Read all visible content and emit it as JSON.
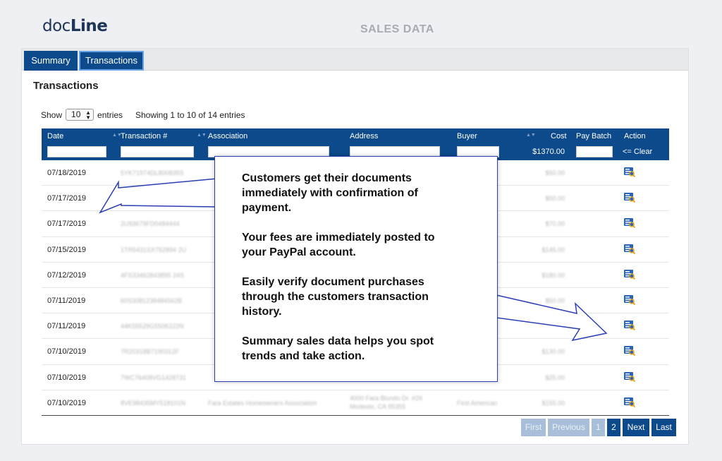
{
  "header": {
    "logo_part1": "doc",
    "logo_part2": "Line",
    "page_title": "SALES DATA"
  },
  "tabs": [
    {
      "label": "Summary"
    },
    {
      "label": "Transactions"
    }
  ],
  "section_title": "Transactions",
  "length_menu": {
    "show": "Show",
    "value": "10",
    "entries": "entries"
  },
  "info": "Showing 1 to 10 of 14 entries",
  "table": {
    "columns": [
      "Date",
      "Transaction #",
      "Association",
      "Address",
      "Buyer",
      "Cost",
      "Pay Batch",
      "Action"
    ],
    "cost_total": "$1370.00",
    "clear_label": "<= Clear",
    "rows": [
      {
        "date": "07/18/2019",
        "txn": "5YK71974DL800835S",
        "cost": "$50.00"
      },
      {
        "date": "07/17/2019",
        "txn": "",
        "cost": "$50.00"
      },
      {
        "date": "07/17/2019",
        "txn": "2U93679FD0484444",
        "cost": "$70.00"
      },
      {
        "date": "07/15/2019",
        "txn": "1TR5431SX752894 2U",
        "cost": "$145.00"
      },
      {
        "date": "07/12/2019",
        "txn": "4FS33462843895 24S",
        "cost": "$180.00"
      },
      {
        "date": "07/11/2019",
        "txn": "60S3081238484562B",
        "cost": "$50.00"
      },
      {
        "date": "07/11/2019",
        "txn": "44K55529G5506222N",
        "cost": ""
      },
      {
        "date": "07/10/2019",
        "txn": "7R20318B7190312F",
        "cost": "$130.00"
      },
      {
        "date": "07/10/2019",
        "txn": "7WC76408VG1428731",
        "cost": "$25.00"
      },
      {
        "date": "07/10/2019",
        "txn": "8VE98435MY518101N",
        "cost": "$155.00",
        "association": "Fara Estates Homeowners Association",
        "address_line1": "4000 Fara Blundo Dr. #26",
        "address_line2": "Modesto, CA 95355",
        "buyer": "First American"
      }
    ]
  },
  "pagination": [
    "First",
    "Previous",
    "1",
    "2",
    "Next",
    "Last"
  ],
  "callout": [
    "Customers get their documents immediately with confirmation of payment.",
    "Your fees are immediately posted to your PayPal account.",
    "Easily verify document purchases through the customers transaction history.",
    "Summary sales data helps you spot trends and take action."
  ],
  "colors": {
    "primary": "#0c4a8b",
    "pager_disabled": "#a9bfd9",
    "callout_border": "#2b3fb5"
  },
  "icons": {
    "action": "document-search-icon"
  }
}
